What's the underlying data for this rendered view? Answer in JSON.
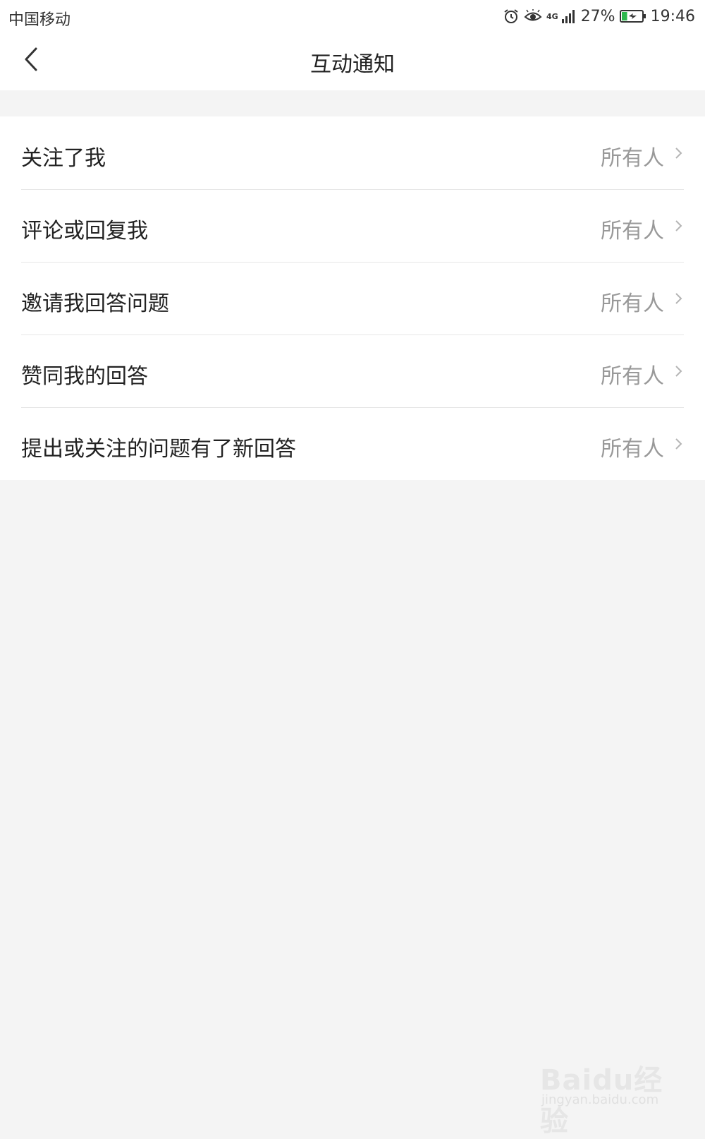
{
  "status_bar": {
    "carrier": "中国移动",
    "network": "4G",
    "battery_percent": "27%",
    "time": "19:46",
    "icons": [
      "alarm-icon",
      "eye-icon",
      "signal-icon",
      "battery-charging-icon"
    ],
    "battery_level": 0.27,
    "battery_color": "#2db84d"
  },
  "header": {
    "title": "互动通知",
    "back_icon": "chevron-left-icon"
  },
  "settings": [
    {
      "label": "关注了我",
      "value": "所有人"
    },
    {
      "label": "评论或回复我",
      "value": "所有人"
    },
    {
      "label": "邀请我回答问题",
      "value": "所有人"
    },
    {
      "label": "赞同我的回答",
      "value": "所有人"
    },
    {
      "label": "提出或关注的问题有了新回答",
      "value": "所有人"
    }
  ],
  "watermark": {
    "brand": "Baidu经验",
    "url": "jingyan.baidu.com"
  },
  "colors": {
    "background": "#f4f4f4",
    "surface": "#ffffff",
    "text_primary": "#222222",
    "text_secondary": "#999999",
    "divider": "#e6e6e6"
  }
}
